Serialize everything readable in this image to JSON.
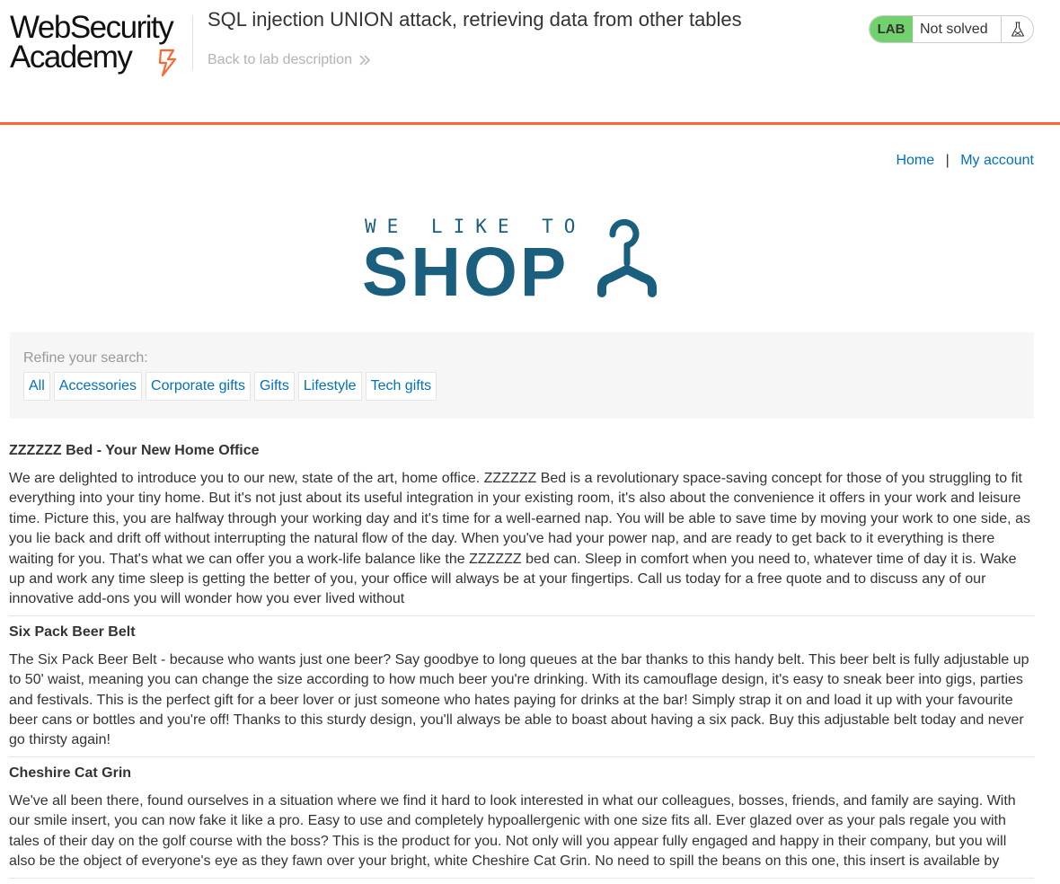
{
  "header": {
    "logo_line1": "WebSecurity",
    "logo_line2": "Academy",
    "lab_title": "SQL injection UNION attack, retrieving data from other tables",
    "back_link": "Back to lab description",
    "lab_badge": "LAB",
    "status": "Not solved"
  },
  "nav": {
    "home": "Home",
    "separator": "|",
    "account": "My account"
  },
  "banner": {
    "small": "WE LIKE TO",
    "big": "SHOP"
  },
  "filters": {
    "label": "Refine your search:",
    "items": [
      "All",
      "Accessories",
      "Corporate gifts",
      "Gifts",
      "Lifestyle",
      "Tech gifts"
    ]
  },
  "products": [
    {
      "name": "ZZZZZZ Bed - Your New Home Office",
      "description": "We are delighted to introduce you to our new, state of the art, home office. ZZZZZZ Bed is a revolutionary space-saving concept for those of you struggling to fit everything into your tiny home. But it's not just about its useful integration in your existing room, it's also about the convenience it offers in your work and leisure time. Picture this, you are halfway through your working day and it's time for a well-earned nap. You will be able to save time by moving your work to one side, as you lie back and drift off without interrupting the natural flow of the day. When you've had your power nap, and are ready to get back to it everything is there waiting for you. That's what we can offer you a work-life balance like the ZZZZZZ bed can. Sleep in comfort when you need to, whatever time of day it is. Wake up and work any time sleep is getting the better of you, your office will always be at your fingertips. Call us today for a free quote and to discuss any of our innovative add-ons you will wonder how you ever lived without"
    },
    {
      "name": "Six Pack Beer Belt",
      "description": "The Six Pack Beer Belt - because who wants just one beer? Say goodbye to long queues at the bar thanks to this handy belt. This beer belt is fully adjustable up to 50' waist, meaning you can change the size according to how much beer you're drinking. With its camouflage design, it's easy to sneak beer into gigs, parties and festivals. This is the perfect gift for a beer lover or just someone who hates paying for drinks at the bar! Simply strap it on and load it up with your favourite beer cans or bottles and you're off! Thanks to this sturdy design, you'll always be able to boast about having a six pack. Buy this adjustable belt today and never go thirsty again!"
    },
    {
      "name": "Cheshire Cat Grin",
      "description": "We've all been there, found ourselves in a situation where we find it hard to look interested in what our colleagues, bosses, friends, and family are saying. With our smile insert, you can now fake it like a pro. Easy to use and completely hypoallergenic with one size fits all. Ever glazed over as your pals regale you with tales of their day on the golf course with the boss? This is the product for you. Not only will you appear fully engaged and happy in their company, but you will also be the object of everyone's eye as they fawn over your bright, white Cheshire Cat Grin. No need to spill the beans on this one, this insert is available by"
    }
  ],
  "colors": {
    "accent_orange": "#ff6633",
    "lab_green": "#70d16d",
    "link_blue": "#0071bc",
    "banner_teal": "#1a5f7e"
  }
}
